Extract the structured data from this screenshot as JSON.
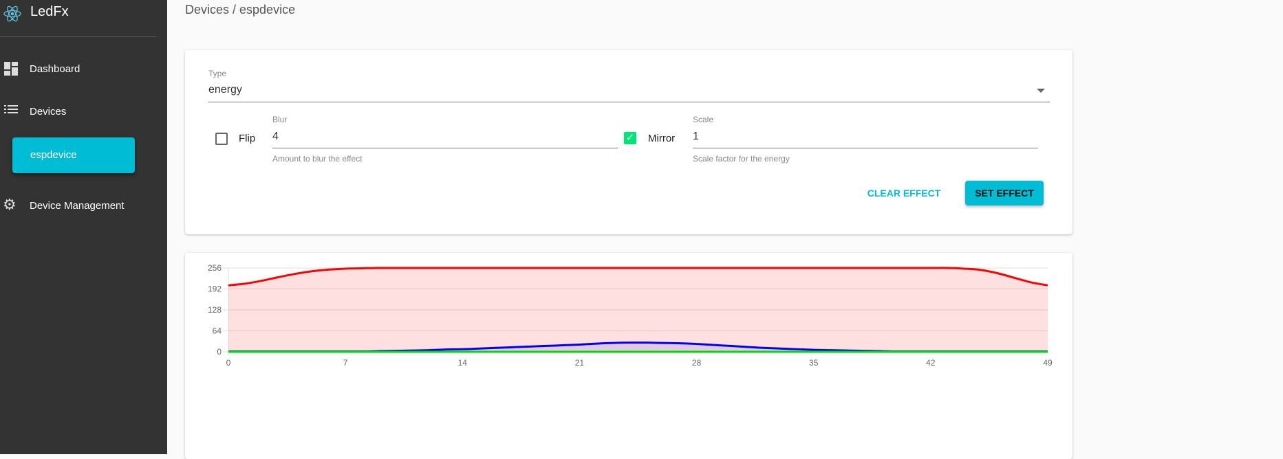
{
  "app": {
    "title": "LedFx"
  },
  "sidebar": {
    "items": [
      {
        "label": "Dashboard",
        "icon": "dashboard-icon"
      },
      {
        "label": "Devices",
        "icon": "list-icon"
      },
      {
        "label": "espdevice"
      },
      {
        "label": "Device Management",
        "icon": "gear-icon"
      }
    ]
  },
  "breadcrumb": "Devices / espdevice",
  "effect": {
    "type_label": "Type",
    "type_value": "energy",
    "flip_label": "Flip",
    "flip_checked": false,
    "blur_label": "Blur",
    "blur_value": "4",
    "blur_help": "Amount to blur the effect",
    "mirror_label": "Mirror",
    "mirror_checked": true,
    "scale_label": "Scale",
    "scale_value": "1",
    "scale_help": "Scale factor for the energy",
    "clear_label": "CLEAR EFFECT",
    "set_label": "SET EFFECT"
  },
  "colors": {
    "accent": "#00bcd4",
    "sidebar": "#333333",
    "checkbox": "#00e676"
  },
  "chart_data": {
    "type": "area",
    "x": [
      0,
      1,
      2,
      3,
      4,
      5,
      6,
      7,
      8,
      9,
      10,
      11,
      12,
      13,
      14,
      15,
      16,
      17,
      18,
      19,
      20,
      21,
      22,
      23,
      24,
      25,
      26,
      27,
      28,
      29,
      30,
      31,
      32,
      33,
      34,
      35,
      36,
      37,
      38,
      39,
      40,
      41,
      42,
      43,
      44,
      45,
      46,
      47,
      48,
      49
    ],
    "xticks": [
      0,
      7,
      14,
      21,
      28,
      35,
      42,
      49
    ],
    "yticks": [
      0,
      64,
      128,
      192,
      256
    ],
    "ylim": [
      0,
      256
    ],
    "xlim": [
      0,
      49
    ],
    "grid": true,
    "series": [
      {
        "color": "#ff0000",
        "values": [
          203,
          208,
          217,
          228,
          238,
          246,
          251,
          254,
          255,
          256,
          256,
          256,
          256,
          256,
          256,
          256,
          256,
          256,
          256,
          256,
          256,
          256,
          256,
          256,
          256,
          256,
          256,
          256,
          256,
          256,
          256,
          256,
          256,
          256,
          256,
          256,
          256,
          256,
          256,
          256,
          256,
          256,
          256,
          256,
          254,
          250,
          240,
          226,
          212,
          203
        ]
      },
      {
        "color": "#0000ff",
        "values": [
          1,
          1,
          1,
          1,
          1,
          1,
          1,
          1,
          1,
          2,
          3,
          4,
          5,
          7,
          8,
          10,
          12,
          14,
          16,
          18,
          20,
          22,
          25,
          27,
          28,
          28,
          27,
          26,
          24,
          21,
          18,
          15,
          12,
          10,
          8,
          6,
          5,
          4,
          3,
          2,
          1,
          1,
          1,
          1,
          1,
          1,
          1,
          1,
          1,
          1
        ]
      },
      {
        "color": "#00dd00",
        "values": [
          0,
          0,
          0,
          0,
          0,
          0,
          0,
          0,
          0,
          0,
          0,
          0,
          0,
          0,
          0,
          0,
          0,
          0,
          0,
          0,
          0,
          0,
          0,
          0,
          0,
          0,
          0,
          0,
          0,
          0,
          0,
          0,
          0,
          0,
          0,
          0,
          0,
          0,
          0,
          0,
          0,
          0,
          0,
          0,
          0,
          0,
          0,
          0,
          0,
          0
        ]
      }
    ]
  }
}
